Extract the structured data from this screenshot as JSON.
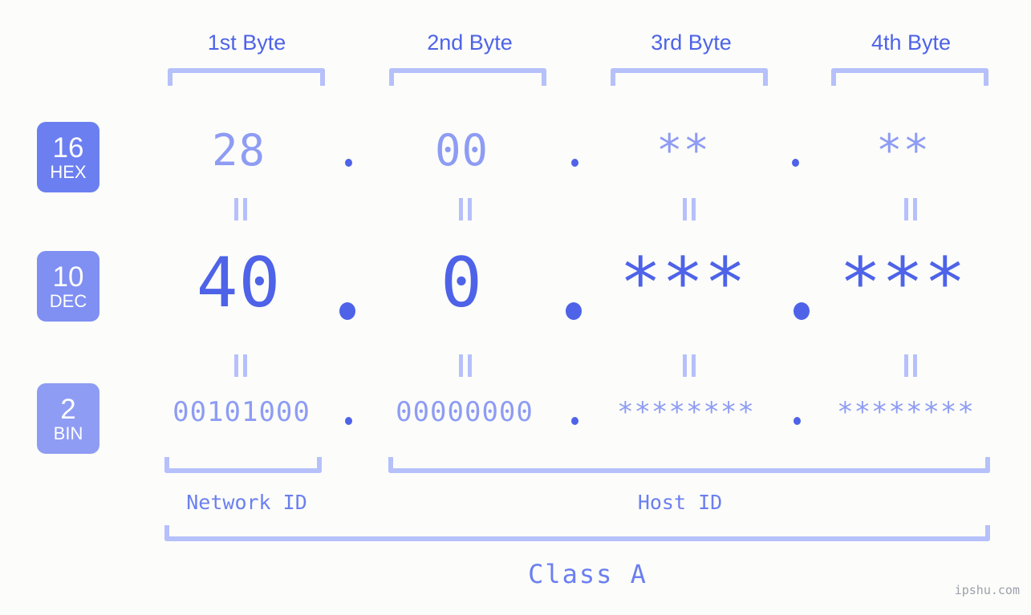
{
  "header": {
    "byte_labels": [
      "1st Byte",
      "2nd Byte",
      "3rd Byte",
      "4th Byte"
    ]
  },
  "rows": [
    {
      "badge_number": "16",
      "badge_radix": "HEX",
      "badge_color": "#6b7ff0",
      "values": [
        "28",
        "00",
        "**",
        "**"
      ],
      "separator": "."
    },
    {
      "badge_number": "10",
      "badge_radix": "DEC",
      "badge_color": "#7f8ff2",
      "values": [
        "40",
        "0",
        "***",
        "***"
      ],
      "separator": "."
    },
    {
      "badge_number": "2",
      "badge_radix": "BIN",
      "badge_color": "#8e9cf4",
      "values": [
        "00101000",
        "00000000",
        "********",
        "********"
      ],
      "separator": "."
    }
  ],
  "equality_mark": "||",
  "footer": {
    "network_id_label": "Network ID",
    "host_id_label": "Host ID",
    "class_label": "Class A"
  },
  "watermark": "ipshu.com",
  "colors": {
    "background": "#fcfdfa",
    "accent_strong": "#4e63e8",
    "accent_mid": "#6b7ff0",
    "accent_light": "#8e9cf4",
    "bracket": "#b6c0fb",
    "watermark": "#9aa0ab"
  }
}
